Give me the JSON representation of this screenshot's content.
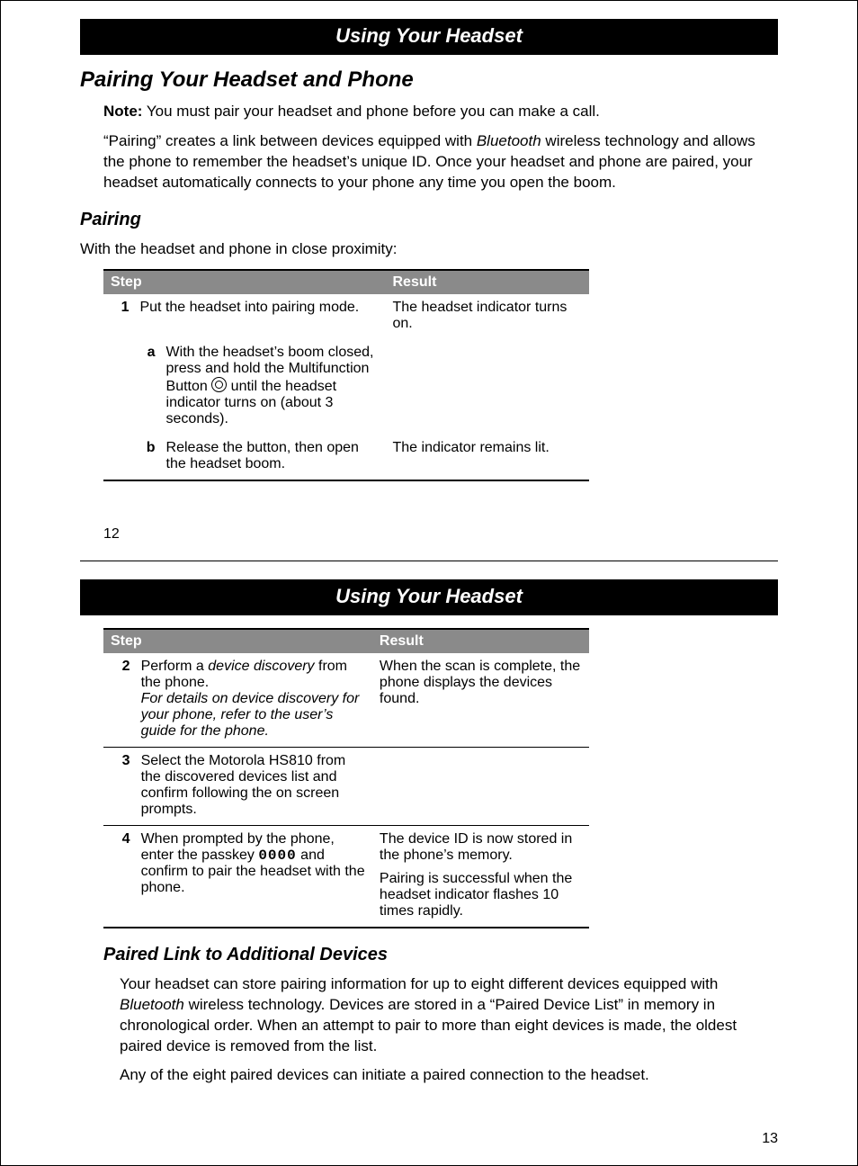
{
  "banner": "Using Your Headset",
  "h1": "Pairing Your Headset and Phone",
  "note_label": "Note:",
  "note_text": " You must pair your headset and phone before you can make a call.",
  "pairing_desc_a": "“Pairing” creates a link between devices equipped with ",
  "bt": "Bluetooth",
  "pairing_desc_b": "  wireless technology and allows the phone to remember the headset’s unique ID. Once your headset and phone are paired, your headset automatically connects to your phone any time you open the boom.",
  "h2_pairing": "Pairing",
  "pairing_intro": "With the headset and phone in close proximity:",
  "th_step": "Step",
  "th_result": "Result",
  "r1_num": "1",
  "r1_action": "Put the headset into pairing mode.",
  "r1_result": "The headset indicator turns on.",
  "r1a_sub": "a",
  "r1a_a": "With the headset’s boom closed, press and hold the Multifunction Button ",
  "r1a_b": " until the headset indicator turns on (about 3 seconds).",
  "r1b_sub": "b",
  "r1b_action": "Release the button, then open the headset boom.",
  "r1b_result": "The indicator remains lit.",
  "page12": "12",
  "r2_num": "2",
  "r2_a": "Perform a ",
  "r2_dd": "device discovery",
  "r2_b": "  from the phone.",
  "r2_ital": "For details on device discovery for your phone, refer to the user’s guide for the phone.",
  "r2_result": "When the scan is complete, the phone displays the devices found.",
  "r3_num": "3",
  "r3_action": "Select the Motorola HS810 from the discovered devices list and confirm following the on screen prompts.",
  "r4_num": "4",
  "r4_a": "When prompted by the phone, enter the passkey ",
  "r4_code": "0000",
  "r4_b": " and confirm to pair the headset with the phone.",
  "r4_res1": "The device ID is now stored in the phone’s memory.",
  "r4_res2": "Pairing is successful when the headset indicator flashes 10 times rapidly.",
  "h2_additional": "Paired Link to Additional Devices",
  "add_a": "Your headset can store pairing information for up to eight different devices equipped with ",
  "add_b": "  wireless technology. Devices are stored in a “Paired Device List” in memory in chronological order. When an attempt to pair to more than eight devices is made, the oldest paired device is removed from the list.",
  "add_c": "Any of the eight paired devices can initiate a paired connection to the headset.",
  "page13": "13"
}
